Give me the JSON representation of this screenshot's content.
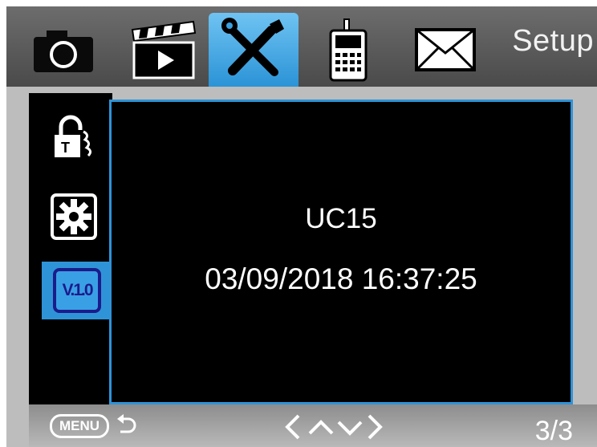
{
  "header": {
    "tabs": [
      {
        "icon": "camera-icon"
      },
      {
        "icon": "video-clapper-icon"
      },
      {
        "icon": "tools-icon",
        "active": true
      },
      {
        "icon": "cellular-phone-icon"
      },
      {
        "icon": "envelope-icon"
      }
    ],
    "title": "Setup"
  },
  "sidebar": {
    "items": [
      {
        "icon": "password-lock-icon"
      },
      {
        "icon": "reset-gear-icon"
      },
      {
        "icon": "version-icon",
        "label": "V.1.0",
        "active": true
      }
    ]
  },
  "main": {
    "model": "UC15",
    "datetime": "03/09/2018 16:37:25"
  },
  "footer": {
    "menu_label": "MENU",
    "page": "3/3"
  },
  "colors": {
    "accent": "#2f93d8",
    "panel": "#000000",
    "bezel": "#bdbdbd"
  }
}
